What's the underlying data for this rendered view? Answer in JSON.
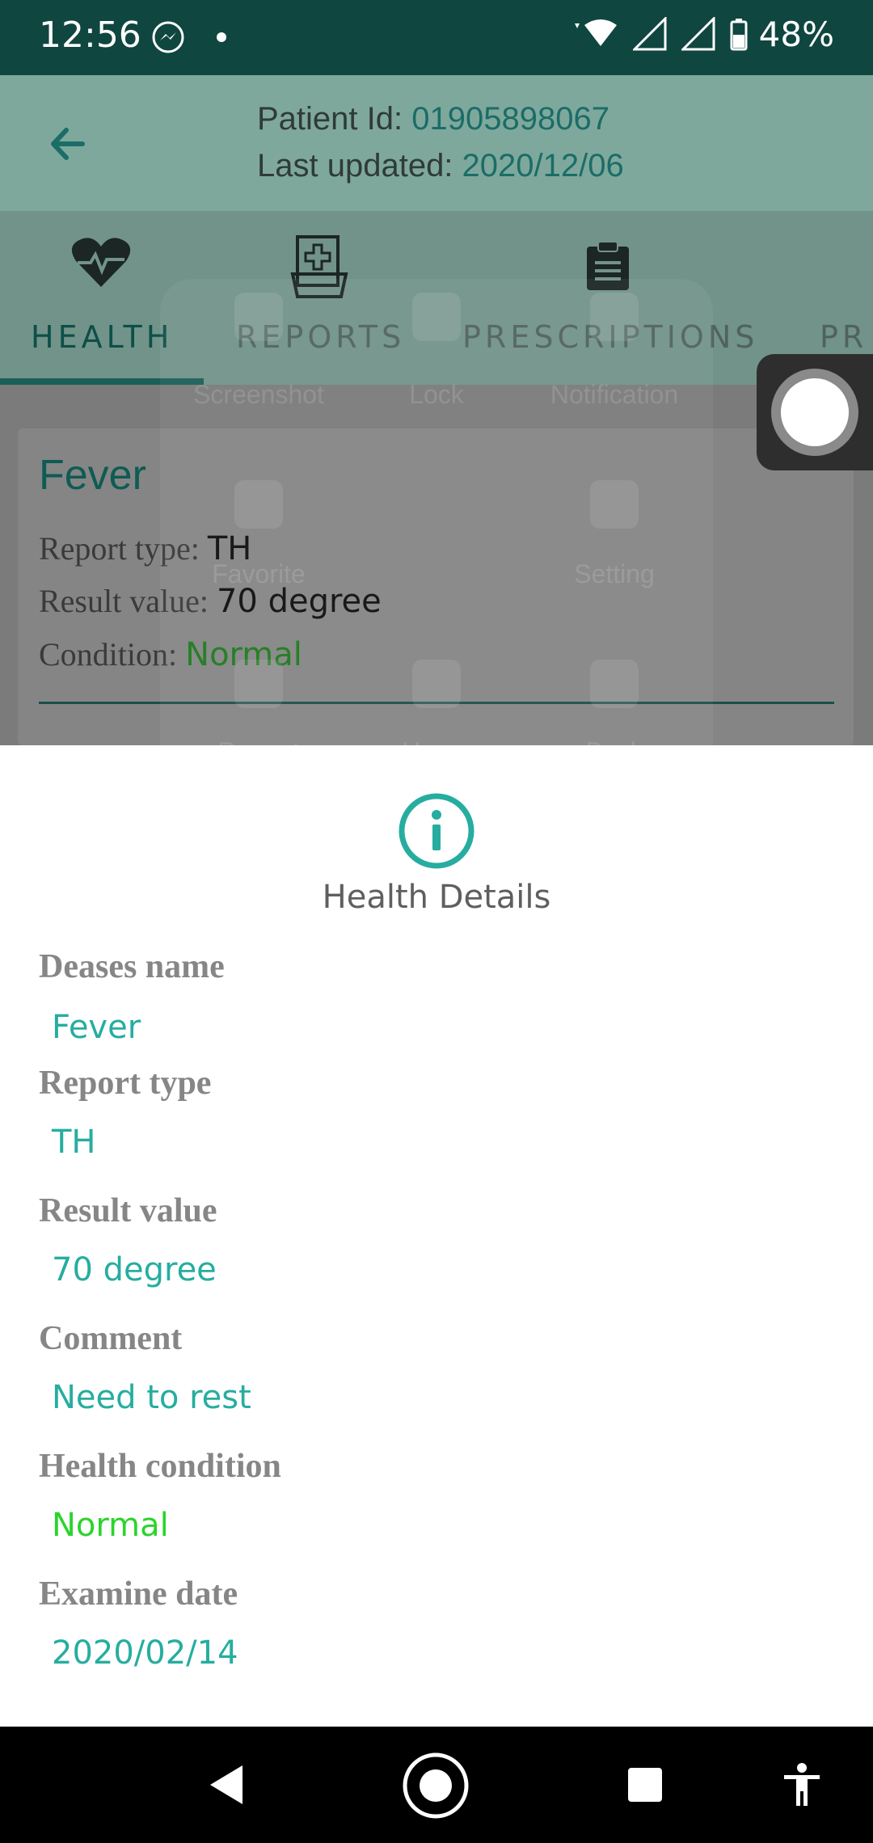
{
  "status_bar": {
    "time": "12:56",
    "battery": "48%",
    "icons": [
      "messenger-icon",
      "dot-icon",
      "wifi-icon",
      "signal-icon",
      "battery-icon"
    ]
  },
  "header": {
    "patient_label": "Patient Id:",
    "patient_id": "01905898067",
    "updated_label": "Last updated:",
    "updated_date": "2020/12/06"
  },
  "tabs": [
    {
      "label": "HEALTH",
      "icon": "heartbeat-icon"
    },
    {
      "label": "REPORTS",
      "icon": "medical-folder-icon"
    },
    {
      "label": "PRESCRIPTIONS",
      "icon": "clipboard-icon"
    },
    {
      "label": "PR",
      "icon": ""
    }
  ],
  "card": {
    "title": "Fever",
    "report_type_label": "Report type:",
    "report_type": "TH",
    "result_label": "Result value:",
    "result_value": "70 degree",
    "condition_label": "Condition:",
    "condition": "Normal"
  },
  "quick_menu": [
    "Screenshot",
    "Lock",
    "Notification",
    "Favorite",
    "Setting",
    "Recent",
    "Home",
    "Back"
  ],
  "sheet": {
    "title": "Health Details",
    "fields": [
      {
        "label": "Deases name",
        "value": "Fever"
      },
      {
        "label": "Report type",
        "value": "TH"
      },
      {
        "label": "Result value",
        "value": "70 degree"
      },
      {
        "label": "Comment",
        "value": "Need to rest"
      },
      {
        "label": "Health condition",
        "value": "Normal"
      },
      {
        "label": "Examine date",
        "value": "2020/02/14"
      }
    ]
  },
  "colors": {
    "accent": "#26ada0",
    "condition_green": "#2bd42b",
    "status_bar": "#0f4640"
  }
}
